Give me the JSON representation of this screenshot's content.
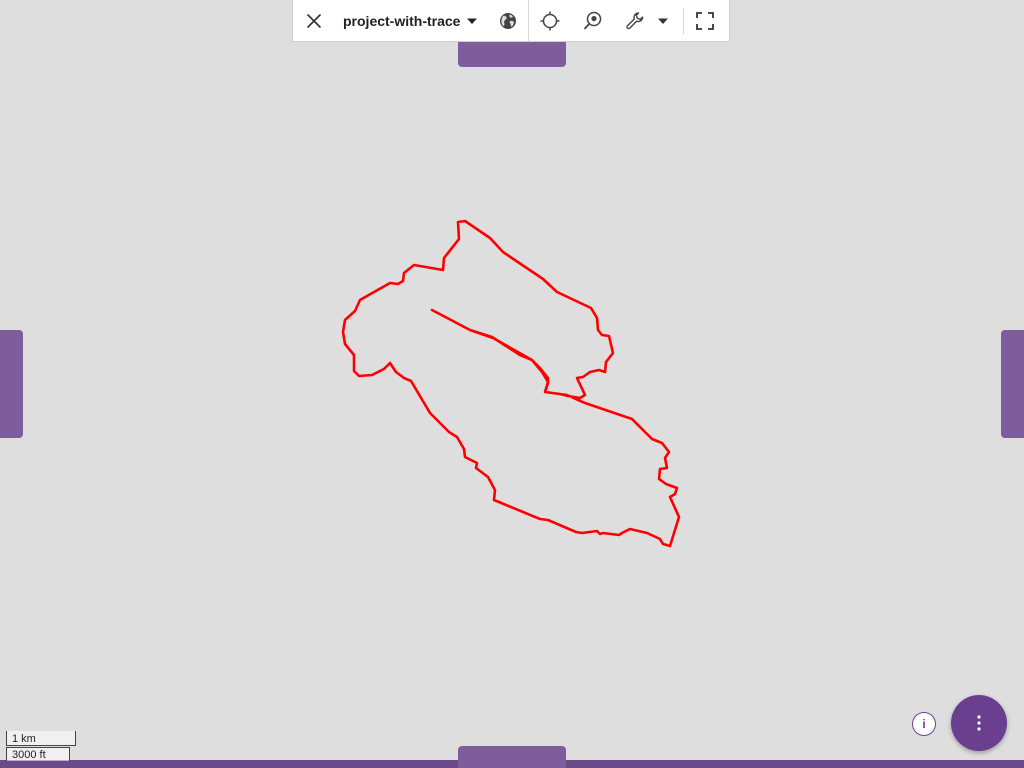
{
  "toolbar": {
    "close_icon": "close-icon",
    "project_name": "project-with-trace",
    "project_dropdown_icon": "caret-down-icon",
    "basemap_icon": "globe-icon",
    "locate_icon": "crosshair-icon",
    "search_location_icon": "map-pin-search-icon",
    "tools_icon": "wrench-icon",
    "tools_dropdown_icon": "caret-down-icon",
    "fullscreen_icon": "fullscreen-icon"
  },
  "map": {
    "trace_color": "#ff0000",
    "background_color": "#dfdedf"
  },
  "scale": {
    "metric": "1 km",
    "imperial": "3000 ft"
  },
  "info_button": {
    "label": "i"
  },
  "fab": {
    "icon": "more-vert-icon"
  },
  "colors": {
    "accent": "#6b3f8f",
    "drawer_handle": "#7f5c9c"
  }
}
